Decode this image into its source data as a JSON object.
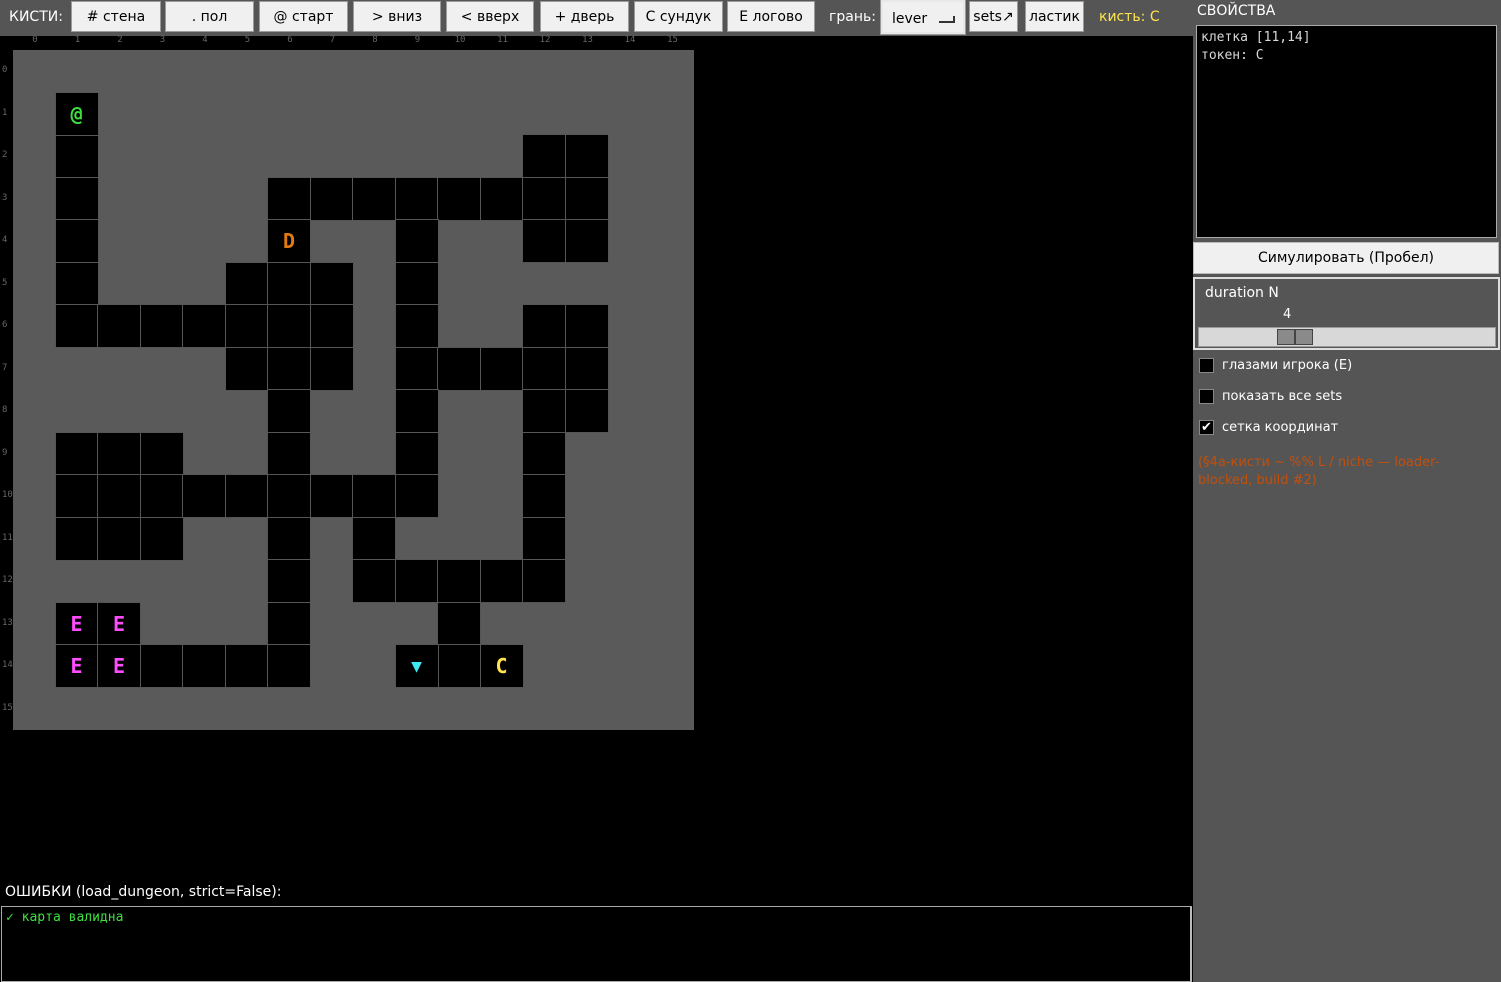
{
  "toolbar": {
    "brushes_label": "КИСТИ:",
    "brushes": [
      {
        "label": "# стена",
        "name": "brush-wall-button"
      },
      {
        "label": ". пол",
        "name": "brush-floor-button"
      },
      {
        "label": "@ старт",
        "name": "brush-start-button"
      },
      {
        "label": "> вниз",
        "name": "brush-down-button"
      },
      {
        "label": "< вверх",
        "name": "brush-up-button"
      },
      {
        "label": "+ дверь",
        "name": "brush-door-button"
      },
      {
        "label": "C сундук",
        "name": "brush-chest-button"
      },
      {
        "label": "E логово",
        "name": "brush-lair-button"
      }
    ],
    "edges_label": "грань:",
    "edge_select": "lever",
    "sets_button": "sets↗",
    "eraser_button": "ластик",
    "current_brush": "кисть: C"
  },
  "grid": {
    "size": 16,
    "columns": [
      "0",
      "1",
      "2",
      "3",
      "4",
      "5",
      "6",
      "7",
      "8",
      "9",
      "10",
      "11",
      "12",
      "13",
      "14",
      "15"
    ],
    "rows": [
      "0",
      "1",
      "2",
      "3",
      "4",
      "5",
      "6",
      "7",
      "8",
      "9",
      "10",
      "11",
      "12",
      "13",
      "14",
      "15"
    ],
    "wall_cells": [
      [
        1,
        2
      ],
      [
        12,
        2
      ],
      [
        13,
        2
      ],
      [
        1,
        3
      ],
      [
        6,
        3
      ],
      [
        7,
        3
      ],
      [
        8,
        3
      ],
      [
        9,
        3
      ],
      [
        10,
        3
      ],
      [
        11,
        3
      ],
      [
        12,
        3
      ],
      [
        13,
        3
      ],
      [
        1,
        4
      ],
      [
        9,
        4
      ],
      [
        12,
        4
      ],
      [
        13,
        4
      ],
      [
        1,
        5
      ],
      [
        5,
        5
      ],
      [
        6,
        5
      ],
      [
        7,
        5
      ],
      [
        9,
        5
      ],
      [
        1,
        6
      ],
      [
        2,
        6
      ],
      [
        3,
        6
      ],
      [
        4,
        6
      ],
      [
        5,
        6
      ],
      [
        6,
        6
      ],
      [
        7,
        6
      ],
      [
        9,
        6
      ],
      [
        12,
        6
      ],
      [
        13,
        6
      ],
      [
        5,
        7
      ],
      [
        6,
        7
      ],
      [
        7,
        7
      ],
      [
        9,
        7
      ],
      [
        10,
        7
      ],
      [
        11,
        7
      ],
      [
        12,
        7
      ],
      [
        13,
        7
      ],
      [
        6,
        8
      ],
      [
        9,
        8
      ],
      [
        12,
        8
      ],
      [
        13,
        8
      ],
      [
        1,
        9
      ],
      [
        2,
        9
      ],
      [
        3,
        9
      ],
      [
        6,
        9
      ],
      [
        9,
        9
      ],
      [
        12,
        9
      ],
      [
        1,
        10
      ],
      [
        2,
        10
      ],
      [
        3,
        10
      ],
      [
        4,
        10
      ],
      [
        5,
        10
      ],
      [
        6,
        10
      ],
      [
        7,
        10
      ],
      [
        8,
        10
      ],
      [
        9,
        10
      ],
      [
        12,
        10
      ],
      [
        1,
        11
      ],
      [
        2,
        11
      ],
      [
        3,
        11
      ],
      [
        6,
        11
      ],
      [
        8,
        11
      ],
      [
        12,
        11
      ],
      [
        6,
        12
      ],
      [
        8,
        12
      ],
      [
        9,
        12
      ],
      [
        10,
        12
      ],
      [
        11,
        12
      ],
      [
        12,
        12
      ],
      [
        6,
        13
      ],
      [
        10,
        13
      ],
      [
        2,
        14
      ],
      [
        3,
        14
      ],
      [
        4,
        14
      ],
      [
        5,
        14
      ],
      [
        6,
        14
      ],
      [
        10,
        14
      ]
    ],
    "tokens": [
      {
        "cell": [
          1,
          1
        ],
        "glyph": "@",
        "color": "#3ee03e",
        "name": "start-token"
      },
      {
        "cell": [
          6,
          4
        ],
        "glyph": "D",
        "color": "#e07a10",
        "name": "door-token"
      },
      {
        "cell": [
          1,
          13
        ],
        "glyph": "E",
        "color": "#ff4cff",
        "name": "lair-token"
      },
      {
        "cell": [
          2,
          13
        ],
        "glyph": "E",
        "color": "#ff4cff",
        "name": "lair-token"
      },
      {
        "cell": [
          1,
          14
        ],
        "glyph": "E",
        "color": "#ff4cff",
        "name": "lair-token"
      },
      {
        "cell": [
          2,
          14
        ],
        "glyph": "E",
        "color": "#ff4cff",
        "name": "lair-token"
      },
      {
        "cell": [
          9,
          14
        ],
        "glyph": "▼",
        "color": "#3ee8f0",
        "name": "stairs-down-token"
      },
      {
        "cell": [
          11,
          14
        ],
        "glyph": "C",
        "color": "#ffe44d",
        "name": "chest-token"
      }
    ]
  },
  "errors": {
    "title": "ОШИБКИ (load_dungeon, strict=False):",
    "message": "✓ карта валидна"
  },
  "sidebar": {
    "props_title": "СВОЙСТВА",
    "props_lines": [
      "клетка [11,14]",
      "токен: C"
    ],
    "simulate_button": "Симулировать (Пробел)",
    "slider_label": "duration N",
    "slider_value": "4",
    "slider_fraction": 0.3,
    "checkboxes": [
      {
        "label": "глазами игрока (E)",
        "checked": false,
        "name": "player-eyes-checkbox"
      },
      {
        "label": "показать все sets",
        "checked": false,
        "name": "show-sets-checkbox"
      },
      {
        "label": "сетка координат",
        "checked": true,
        "name": "coord-grid-checkbox"
      }
    ],
    "note": "(§4a-кисти ~ %% L / niche — loader-blocked, build #2)"
  }
}
